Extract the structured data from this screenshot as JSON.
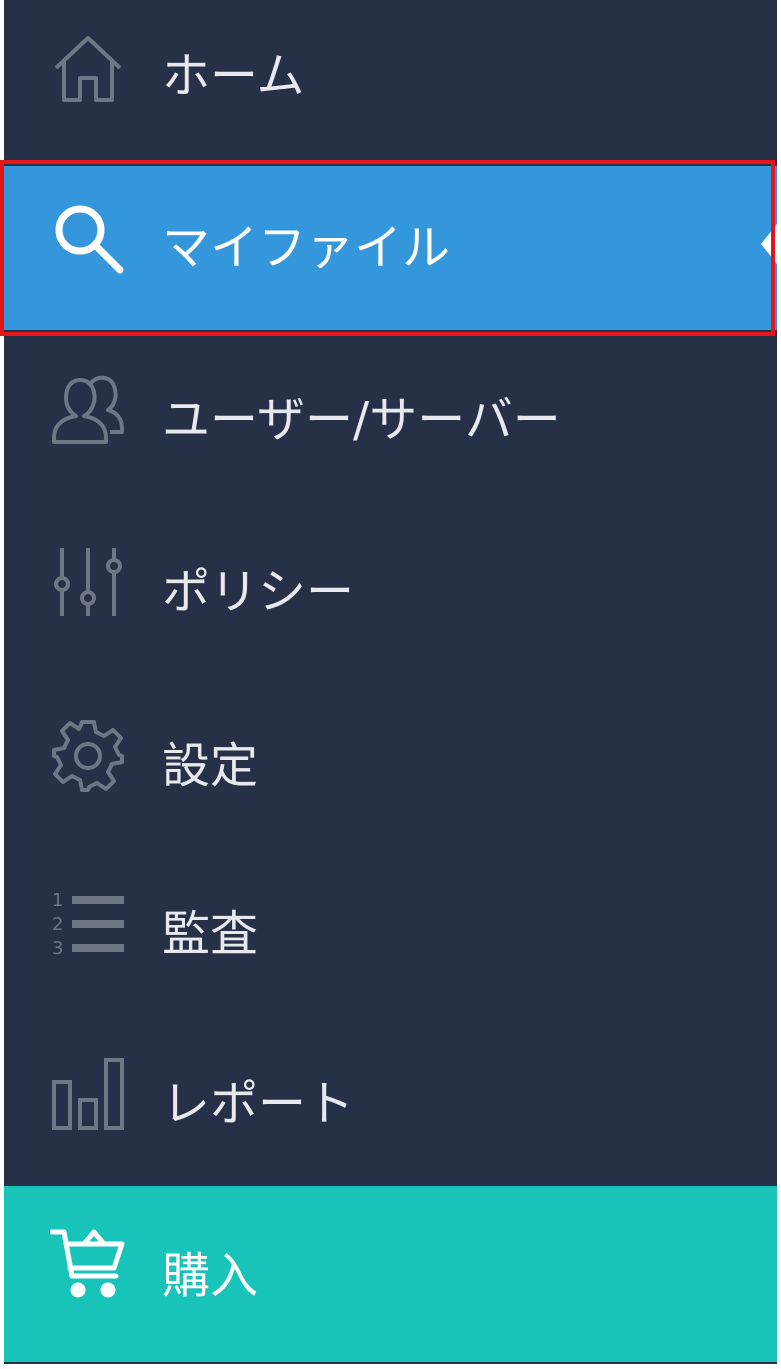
{
  "sidebar": {
    "items": [
      {
        "label": "ホーム",
        "icon": "home-icon"
      },
      {
        "label": "マイファイル",
        "icon": "search-icon",
        "active": true
      },
      {
        "label": "ユーザー/サーバー",
        "icon": "users-icon"
      },
      {
        "label": "ポリシー",
        "icon": "sliders-icon"
      },
      {
        "label": "設定",
        "icon": "gear-icon"
      },
      {
        "label": "監査",
        "icon": "numbered-list-icon"
      },
      {
        "label": "レポート",
        "icon": "bar-chart-icon"
      },
      {
        "label": "購入",
        "icon": "cart-icon"
      }
    ]
  },
  "colors": {
    "sidebar_bg": "#263148",
    "active_bg": "#3597db",
    "purchase_bg": "#18c4b9",
    "highlight_outline": "#e5161b",
    "icon_gray": "#6e7786",
    "text": "#e6e9ee"
  }
}
